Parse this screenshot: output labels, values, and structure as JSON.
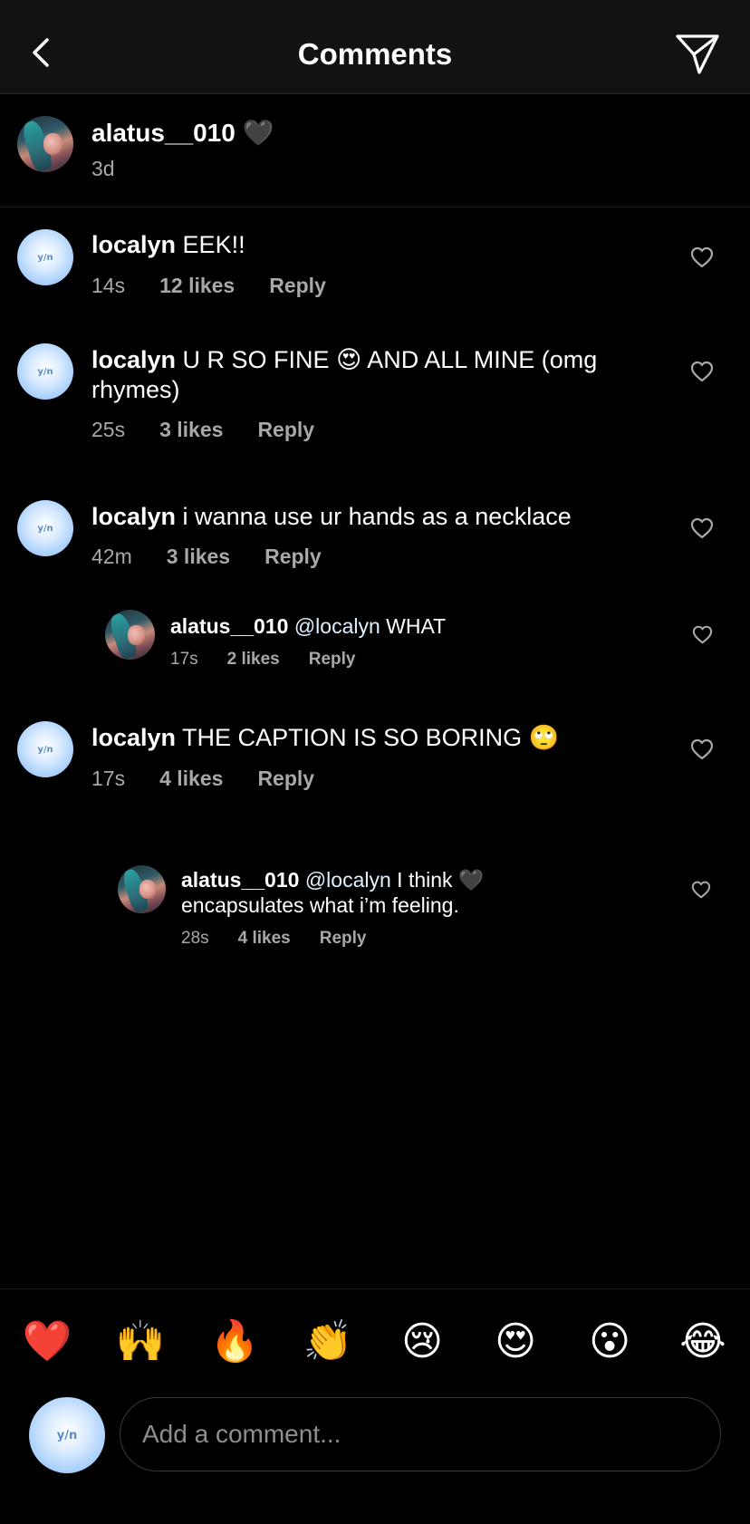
{
  "header": {
    "title": "Comments"
  },
  "caption": {
    "username": "alatus__010",
    "text": "🖤",
    "time": "3d"
  },
  "comments": [
    {
      "username": "localyn",
      "text": " EEK!!",
      "time": "14s",
      "likes": "12 likes",
      "reply": "Reply",
      "avatar_text": "y/n"
    },
    {
      "username": "localyn",
      "text": " U R SO FINE 😍  AND ALL MINE (omg rhymes)",
      "time": "25s",
      "likes": "3 likes",
      "reply": "Reply",
      "avatar_text": "y/n"
    },
    {
      "username": "localyn",
      "text": " i wanna use ur hands as a necklace",
      "time": "42m",
      "likes": "3 likes",
      "reply": "Reply",
      "avatar_text": "y/n"
    },
    {
      "username": "alatus__010",
      "mention": " @localyn",
      "text": " WHAT",
      "time": "17s",
      "likes": "2 likes",
      "reply": "Reply"
    },
    {
      "username": "localyn",
      "text": " THE CAPTION IS SO BORING 🙄",
      "time": "17s",
      "likes": "4 likes",
      "reply": "Reply",
      "avatar_text": "y/n"
    },
    {
      "username": "alatus__010",
      "mention": " @localyn",
      "text": " I think 🖤 encapsulates what i’m feeling.",
      "time": "28s",
      "likes": "4 likes",
      "reply": "Reply"
    }
  ],
  "reactions": [
    "❤️",
    "🙌",
    "🔥",
    "👏",
    "😢",
    "😍",
    "😮",
    "😂"
  ],
  "composer": {
    "avatar_text": "y/n",
    "placeholder": "Add a comment..."
  },
  "colors": {
    "background": "#000000",
    "header": "#121212",
    "meta_text": "#a8a8a8",
    "mention": "#e0f1ff",
    "placeholder": "#8e8e8e"
  }
}
